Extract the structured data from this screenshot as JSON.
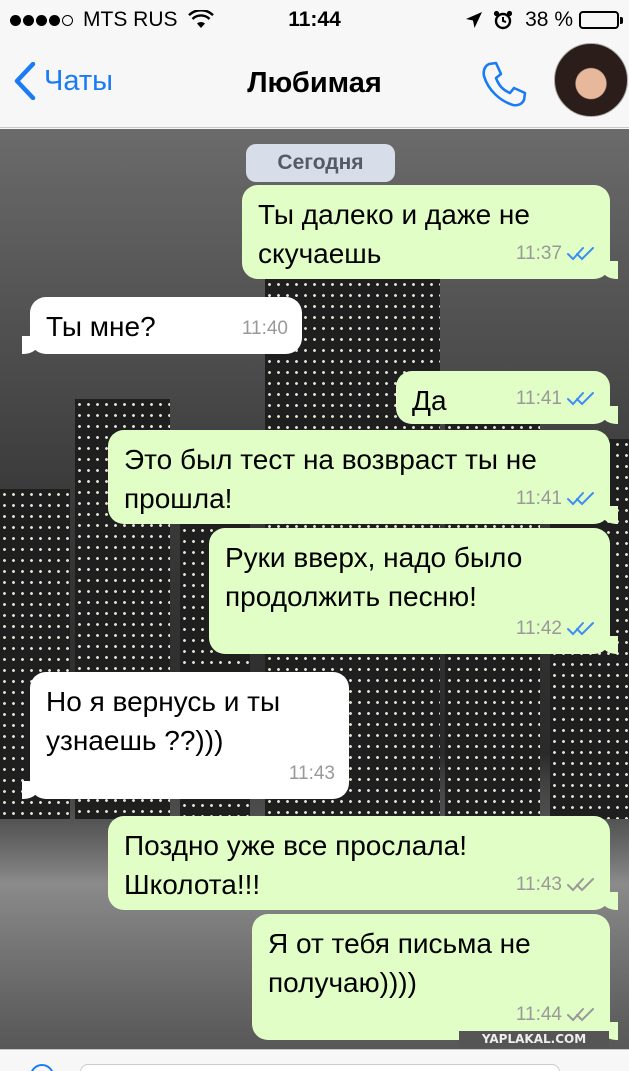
{
  "status_bar": {
    "carrier": "MTS RUS",
    "time": "11:44",
    "battery_percent": "38 %",
    "battery_level": 0.38
  },
  "nav": {
    "back_label": "Чаты",
    "title": "Любимая"
  },
  "chat": {
    "date_label": "Сегодня",
    "messages": [
      {
        "dir": "out",
        "text": "Ты далеко и даже не скучаешь",
        "time": "11:37",
        "read": true
      },
      {
        "dir": "in",
        "text": "Ты мне?",
        "time": "11:40"
      },
      {
        "dir": "out",
        "text": "Да",
        "time": "11:41",
        "read": true
      },
      {
        "dir": "out",
        "text": "Это был тест на возвраст ты не прошла!",
        "time": "11:41",
        "read": true
      },
      {
        "dir": "out",
        "text": "Руки вверх, надо было продолжить песню!",
        "time": "11:42",
        "read": true
      },
      {
        "dir": "in",
        "text": "Но я вернусь и ты узнаешь ??)))",
        "time": "11:43"
      },
      {
        "dir": "out",
        "text": "Поздно уже все прослала! Школота!!!",
        "time": "11:43",
        "read": false
      },
      {
        "dir": "out",
        "text": "Я от тебя письма не получаю))))",
        "time": "11:44",
        "read": false
      }
    ]
  },
  "watermark": "YAPLAKAL.COM",
  "colors": {
    "accent": "#1a7cf5",
    "outgoing_bubble": "#e1fec6",
    "incoming_bubble": "#ffffff",
    "read_ticks": "#3b8ef5",
    "unread_ticks": "#999999"
  }
}
